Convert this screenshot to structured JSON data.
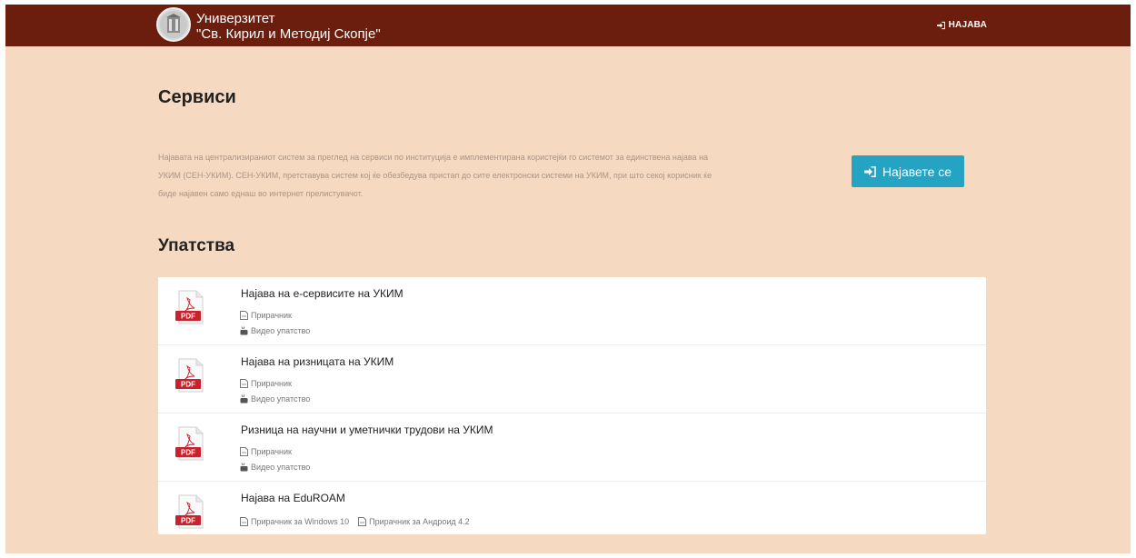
{
  "header": {
    "university_line1": "Универзитет",
    "university_line2": "\"Св. Кирил и Методиј Скопје\"",
    "login_link": "НАЈАВА"
  },
  "services": {
    "title": "Сервиси",
    "description": "Најавата на централизираниот систем за преглед на сервиси по институција е имплементирана користејќи го системот за единствена најава на УКИМ (СЕН-УКИМ). СЕН-УКИМ, претставува систем кој ќе обезбедува пристап до сите електронски системи на УКИМ, при што секој корисник ќе биде најавен само еднаш во интернет прелистувачот.",
    "login_button": "Најавете се"
  },
  "guides": {
    "title": "Упатства",
    "items": [
      {
        "title": "Најава на е-сервисите на УКИМ",
        "links": [
          "Прирачник",
          "Видео упатство"
        ],
        "icon": "pdf-icon"
      },
      {
        "title": "Најава на ризницата на УКИМ",
        "links": [
          "Прирачник",
          "Видео упатство"
        ],
        "icon": "pdf-icon"
      },
      {
        "title": "Ризница на научни и уметнички трудови на УКИМ",
        "links": [
          "Прирачник",
          "Видео упатство"
        ],
        "icon": "pdf-icon"
      },
      {
        "title": "Најава на EduROAM",
        "links": [
          "Прирачник за Windows 10",
          "Прирачник за Андроид 4.2"
        ],
        "icon": "pdf-icon"
      }
    ]
  },
  "colors": {
    "topbar": "#6b1e0e",
    "background": "#f6d9c1",
    "accent_button": "#25a3c2",
    "pdf_red": "#c8232c"
  }
}
